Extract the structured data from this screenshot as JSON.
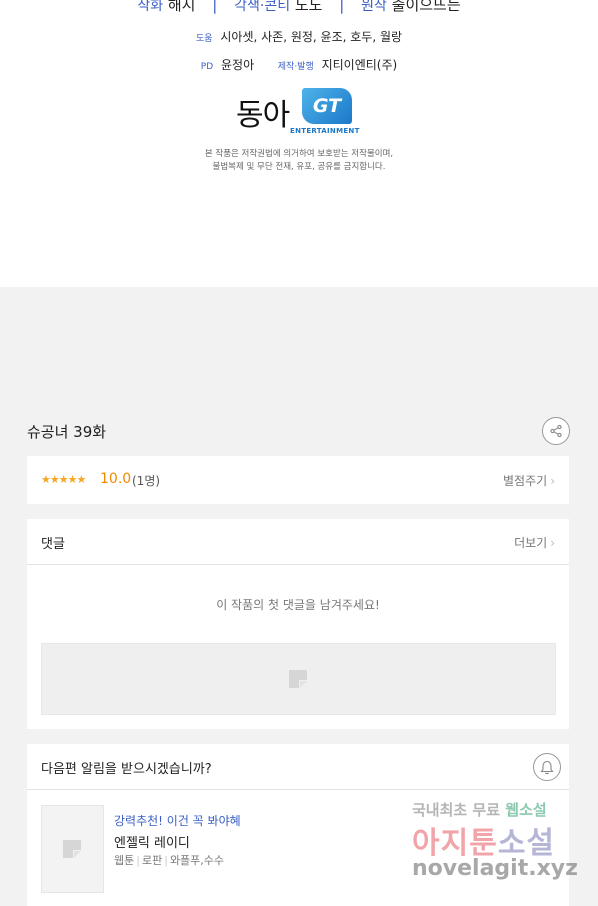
{
  "credits": {
    "art_role": "작화",
    "art_name": "해시",
    "adapt_role": "각색·콘티",
    "adapt_name": "노도",
    "original_role": "원작",
    "original_name": "출이으뜨는",
    "separator": "|",
    "assist_role": "도움",
    "assist_names": "시아셋, 사존, 원정, 윤조, 호두, 월랑",
    "pd_role": "PD",
    "pd_name": "윤정아",
    "producer_role": "제작·발행",
    "producer_name": "지티이엔티(주)",
    "logo_donga": "동아",
    "logo_gt": "GT",
    "logo_gt_sub": "ENTERTAINMENT",
    "copyright_line1": "본 작품은 저작권법에 의거하여 보호받는 저작물이며,",
    "copyright_line2": "불법복제 및 무단 전재, 유포, 공유를 금지합니다."
  },
  "episode": {
    "title": "슈공녀 39화"
  },
  "rating": {
    "stars": "★★★★★",
    "score": "10.0",
    "count": "(1명)",
    "rate_label": "별점주기"
  },
  "comments": {
    "title": "댓글",
    "more_label": "더보기",
    "empty_message": "이 작품의 첫 댓글을 남겨주세요!"
  },
  "notify": {
    "question": "다음편 알림을 받으시겠습니까?"
  },
  "recommendation": {
    "tag": "강력추천! 이건 꼭 봐야혜",
    "title": "엔젤릭 레이디",
    "genre_1": "웹툰",
    "genre_2": "로판",
    "genre_3": "와플푸,수수"
  },
  "watermark": {
    "top_text": "국내최초 무료",
    "top_emphasis": "웹소설",
    "mid_text": "아지툰",
    "mid_emphasis": "소설",
    "url": "novelagit.xyz"
  },
  "colors": {
    "accent_blue": "#3b5fc4",
    "score_orange": "#f08a00",
    "star_yellow": "#f5a623"
  }
}
